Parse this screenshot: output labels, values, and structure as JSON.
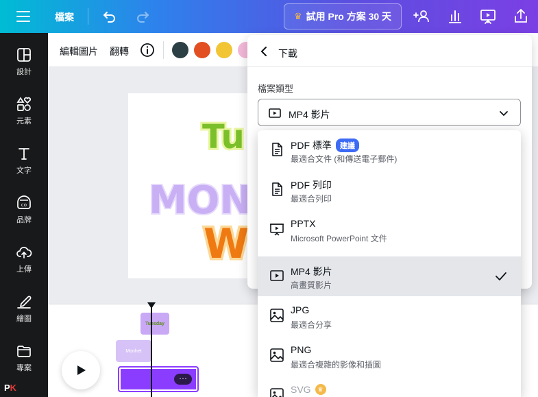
{
  "topbar": {
    "file_label": "檔案",
    "pro_label": "試用 Pro 方案 30 天"
  },
  "sidebar": {
    "items": [
      {
        "label": "設計",
        "icon": "layout-icon"
      },
      {
        "label": "元素",
        "icon": "shapes-icon"
      },
      {
        "label": "文字",
        "icon": "text-icon"
      },
      {
        "label": "品牌",
        "icon": "brand-icon"
      },
      {
        "label": "上傳",
        "icon": "upload-cloud-icon"
      },
      {
        "label": "繪圖",
        "icon": "draw-icon"
      },
      {
        "label": "專案",
        "icon": "folder-icon"
      }
    ],
    "logo_p": "P",
    "logo_k": "K"
  },
  "context_toolbar": {
    "edit_image_label": "編輯圖片",
    "flip_label": "翻轉",
    "swatches": [
      "#2b3f45",
      "#e24f22",
      "#f2c535",
      "#f3b8d8"
    ]
  },
  "canvas": {
    "text_top": "Tu",
    "text_mid": "MONB",
    "text_bottom": "W"
  },
  "timeline": {
    "clip1_label": "Tuesday",
    "clip2_label": "Monhet"
  },
  "download_panel": {
    "title": "下載",
    "file_type_label": "檔案類型",
    "selected_value": "MP4 影片"
  },
  "dropdown": {
    "options": [
      {
        "name": "PDF 標準",
        "badge": "建議",
        "desc": "最適合文件 (和傳送電子郵件)",
        "icon": "document-icon"
      },
      {
        "name": "PDF 列印",
        "desc": "最適合列印",
        "icon": "document-icon"
      },
      {
        "name": "PPTX",
        "desc": "Microsoft PowerPoint 文件",
        "icon": "presentation-icon"
      },
      {
        "name": "MP4 影片",
        "desc": "高畫質影片",
        "icon": "video-icon",
        "selected": true
      },
      {
        "name": "JPG",
        "desc": "最適合分享",
        "icon": "image-icon"
      },
      {
        "name": "PNG",
        "desc": "最適合複雜的影像和插圖",
        "icon": "image-icon"
      },
      {
        "name": "SVG",
        "icon": "image-icon"
      }
    ]
  }
}
